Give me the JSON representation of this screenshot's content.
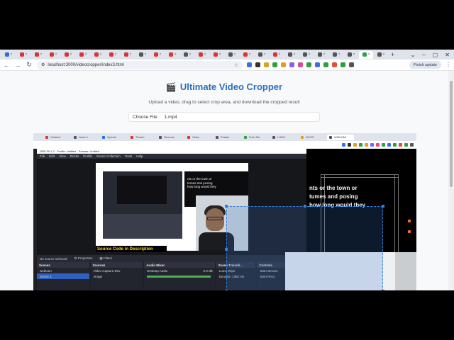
{
  "browser": {
    "tab_count": 26,
    "tab_colors": [
      "#2f6ae0",
      "#d33",
      "#d33",
      "#d33",
      "#d33",
      "#d33",
      "#d33",
      "#d33",
      "#d33",
      "#555",
      "#d33",
      "#d33",
      "#555",
      "#d33",
      "#d33",
      "#555",
      "#d33",
      "#555",
      "#d33",
      "#555",
      "#555",
      "#555",
      "#555",
      "#555",
      "#2f9e44",
      "#555"
    ],
    "url": "localhost:3000/videocropper/index3.html",
    "update_button": "Finish update",
    "extension_colors": [
      "#3b6ee8",
      "#333",
      "#e0a020",
      "#2f9e44",
      "#e0a020",
      "#8a5cf0",
      "#e04a8a",
      "#2f9e44",
      "#3b6ee8",
      "#2f9e44",
      "#e05030",
      "#2f9e44",
      "#555"
    ]
  },
  "app": {
    "title": "Ultimate Video Cropper",
    "subtitle": "Upload a video, drag to select crop area, and download the cropped result",
    "choose_file_label": "Choose File",
    "file_name": "1.mp4"
  },
  "video": {
    "inner_tabs": [
      "Chatbot",
      "react-d",
      "OpenIn",
      "Thumb",
      "Remove",
      "Video",
      "Practic",
      "Free Ste",
      "LUDO",
      "GLOO",
      "WMLWMI"
    ],
    "obs_title": "OBS 30.1.2 - Profile: Untitled - Scenes: Untitled",
    "obs_menu": [
      "File",
      "Edit",
      "View",
      "Docks",
      "Profile",
      "Scene Collection",
      "Tools",
      "Help"
    ],
    "banner": "Source Code in  Description",
    "stage_text": [
      "nts or the town or",
      "tumes and posing",
      "how long would they"
    ],
    "nested_text": [
      "nts or the town or",
      "tumes and posing",
      "how long would they"
    ],
    "status_left": "No source selected",
    "status_props": "Properties",
    "status_filters": "Filters",
    "docks": {
      "scenes": {
        "title": "Scenes",
        "items": [
          "webcam",
          "Scene 2"
        ]
      },
      "sources": {
        "title": "Sources",
        "items": [
          "Video Capture Dev",
          "Image"
        ]
      },
      "mixer": {
        "title": "Audio Mixer",
        "items": [
          "Desktop Audio",
          "0.0 dB"
        ]
      },
      "transitions": {
        "title": "Scene Transiti...",
        "items": [
          "Luma Wipe",
          "Duration 1350 ms"
        ]
      },
      "controls": {
        "title": "Controls",
        "items": [
          "Start Stream",
          "Start Reco"
        ]
      }
    }
  }
}
